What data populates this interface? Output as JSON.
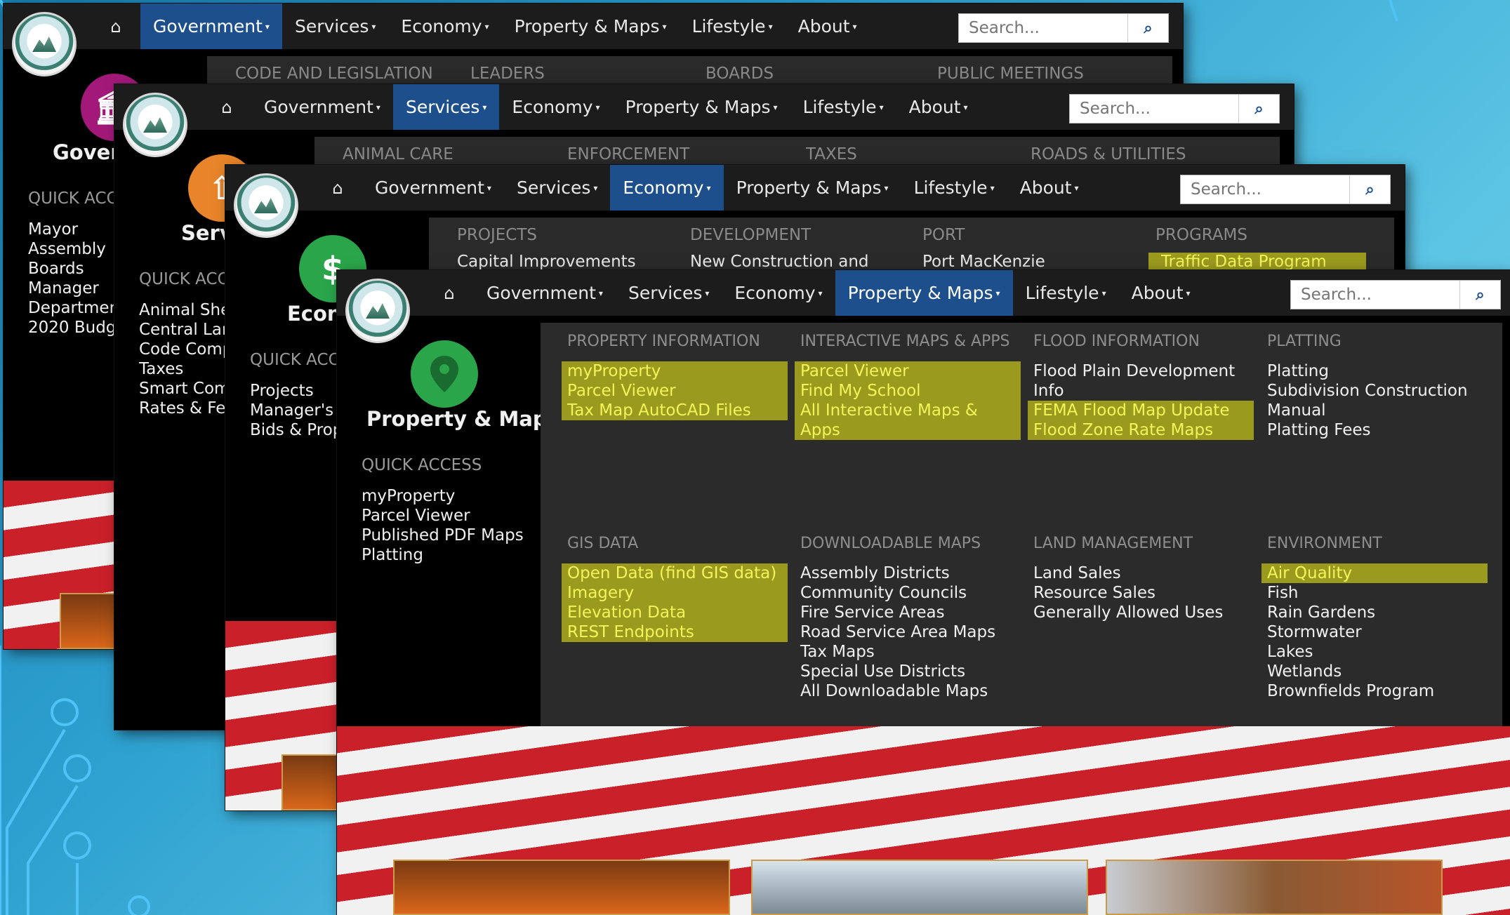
{
  "nav": {
    "home_icon": "home-icon",
    "items": [
      "Government",
      "Services",
      "Economy",
      "Property & Maps",
      "Lifestyle",
      "About"
    ],
    "search_placeholder": "Search..."
  },
  "win1": {
    "active": "Government",
    "submenu": [
      "CODE AND LEGISLATION",
      "LEADERS",
      "BOARDS",
      "PUBLIC MEETINGS"
    ],
    "title": "Goverr",
    "qa": "QUICK ACC",
    "list": [
      "Mayor",
      "Assembly",
      "Boards",
      "Manager",
      "Departmen",
      "2020 Budg"
    ]
  },
  "win2": {
    "active": "Services",
    "submenu": [
      "ANIMAL CARE",
      "ENFORCEMENT",
      "TAXES",
      "ROADS & UTILITIES"
    ],
    "title": "Servi",
    "qa": "QUICK ACC",
    "list": [
      "Animal She",
      "Central Lar",
      "Code Comp",
      "Taxes",
      "Smart Com",
      "Rates & Fee"
    ]
  },
  "win3": {
    "active": "Economy",
    "submenu": [
      "PROJECTS",
      "DEVELOPMENT",
      "PORT",
      "PROGRAMS"
    ],
    "links": [
      "Capital Improvements",
      "New Construction and",
      "Port MacKenzie",
      "Traffic Data Program"
    ],
    "title": "Econ",
    "qa": "QUICK ACC",
    "list": [
      "Projects",
      "Manager's I",
      "Bids & Prop"
    ]
  },
  "win4": {
    "active": "Property & Maps",
    "title": "Property & Maps",
    "qa": "QUICK ACCESS",
    "list": [
      "myProperty",
      "Parcel Viewer",
      "Published PDF Maps",
      "Platting"
    ],
    "columns": [
      {
        "header": "PROPERTY INFORMATION",
        "items": [
          "myProperty",
          "Parcel Viewer",
          "Tax Map AutoCAD Files"
        ]
      },
      {
        "header": "INTERACTIVE MAPS & APPS",
        "items": [
          "Parcel Viewer",
          "Find My School",
          "All Interactive Maps & Apps"
        ]
      },
      {
        "header": "FLOOD INFORMATION",
        "items": [
          "Flood Plain Development Info",
          "FEMA Flood Map Update",
          "Flood Zone Rate Maps"
        ]
      },
      {
        "header": "PLATTING",
        "items": [
          "Platting",
          "Subdivision Construction Manual",
          "Platting Fees"
        ]
      },
      {
        "header": "GIS DATA",
        "items": [
          "Open Data (find GIS data)",
          "Imagery",
          "Elevation Data",
          "REST Endpoints"
        ]
      },
      {
        "header": "DOWNLOADABLE MAPS",
        "items": [
          "Assembly Districts",
          "Community Councils",
          "Fire Service Areas",
          "Road Service Area Maps",
          "Tax Maps",
          "Special Use Districts",
          "All Downloadable Maps"
        ]
      },
      {
        "header": "LAND MANAGEMENT",
        "items": [
          "Land Sales",
          "Resource Sales",
          "Generally Allowed Uses"
        ]
      },
      {
        "header": "ENVIRONMENT",
        "items": [
          "Air Quality",
          "Fish",
          "Rain Gardens",
          "Stormwater",
          "Lakes",
          "Wetlands",
          "Brownfields Program"
        ]
      }
    ]
  },
  "colors": {
    "active_nav": "#1c4f8c",
    "highlight": "#9a9a1f",
    "highlight_text": "#f3f35a",
    "gov_icon": "#a3197a",
    "services_icon": "#e8852a",
    "economy_icon": "#2aa54a",
    "property_icon": "#2aa54a"
  }
}
